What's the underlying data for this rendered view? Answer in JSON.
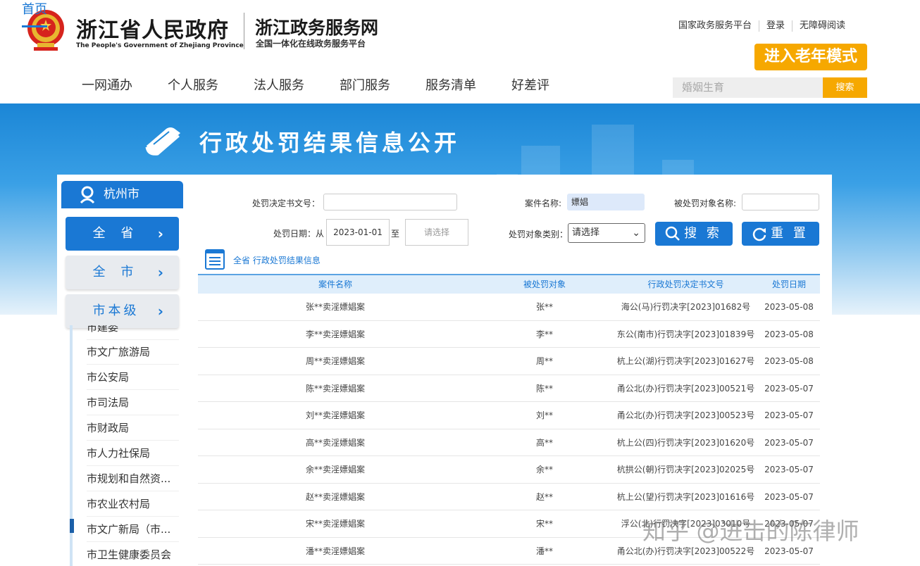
{
  "header": {
    "gov_title": "浙江省人民政府",
    "gov_subtitle": "The People's Government of Zhejiang Province",
    "service_title": "浙江政务服务网",
    "service_subtitle": "全国一体化在线政务服务平台",
    "top_links": [
      "国家政务服务平台",
      "登录",
      "无障碍阅读"
    ],
    "elder_mode": "进入老年模式"
  },
  "nav": {
    "items": [
      "首页",
      "一网通办",
      "个人服务",
      "法人服务",
      "部门服务",
      "服务清单",
      "好差评"
    ],
    "active": "首页"
  },
  "search": {
    "placeholder": "婚姻生育",
    "button": "搜索"
  },
  "banner": {
    "title": "行政处罚结果信息公开"
  },
  "sidebar": {
    "city": "杭州市",
    "buttons": [
      "全 省",
      "全 市",
      "市本级"
    ],
    "items": [
      "市建委",
      "市文广旅游局",
      "市公安局",
      "市司法局",
      "市财政局",
      "市人力社保局",
      "市规划和自然资...",
      "市农业农村局",
      "市文广新局（市...",
      "市卫生健康委员会"
    ]
  },
  "form": {
    "doc_no_label": "处罚决定书文号：",
    "doc_no_value": "",
    "case_name_label": "案件名称:",
    "case_name_value": "嫖娼",
    "target_name_label": "被处罚对象名称:",
    "target_name_value": "",
    "date_label": "处罚日期：从",
    "date_from": "2023-01-01",
    "date_to_label": "至",
    "date_to_placeholder": "请选择",
    "target_type_label": "处罚对象类别：",
    "target_type_value": "请选择",
    "search_button": "搜 索",
    "reset_button": "重 置"
  },
  "crumb": "全省 行政处罚结果信息",
  "table": {
    "headers": [
      "案件名称",
      "被处罚对象",
      "行政处罚决定书文号",
      "处罚日期"
    ],
    "rows": [
      [
        "张**卖淫嫖娼案",
        "张**",
        "海公(马)行罚决字[2023]01682号",
        "2023-05-08"
      ],
      [
        "李**卖淫嫖娼案",
        "李**",
        "东公(南市)行罚决字[2023]01839号",
        "2023-05-08"
      ],
      [
        "周**卖淫嫖娼案",
        "周**",
        "杭上公(湖)行罚决字[2023]01627号",
        "2023-05-08"
      ],
      [
        "陈**卖淫嫖娼案",
        "陈**",
        "甬公北(办)行罚决字[2023]00521号",
        "2023-05-07"
      ],
      [
        "刘**卖淫嫖娼案",
        "刘**",
        "甬公北(办)行罚决字[2023]00523号",
        "2023-05-07"
      ],
      [
        "高**卖淫嫖娼案",
        "高**",
        "杭上公(四)行罚决字[2023]01620号",
        "2023-05-07"
      ],
      [
        "余**卖淫嫖娼案",
        "余**",
        "杭拱公(朝)行罚决字[2023]02025号",
        "2023-05-07"
      ],
      [
        "赵**卖淫嫖娼案",
        "赵**",
        "杭上公(望)行罚决字[2023]01616号",
        "2023-05-07"
      ],
      [
        "宋**卖淫嫖娼案",
        "宋**",
        "浮公(北)行罚决字[2023]03010号",
        "2023-05-07"
      ],
      [
        "潘**卖淫嫖娼案",
        "潘**",
        "甬公北(办)行罚决字[2023]00522号",
        "2023-05-07"
      ]
    ]
  },
  "watermark": "知乎 @进击的陈律师"
}
